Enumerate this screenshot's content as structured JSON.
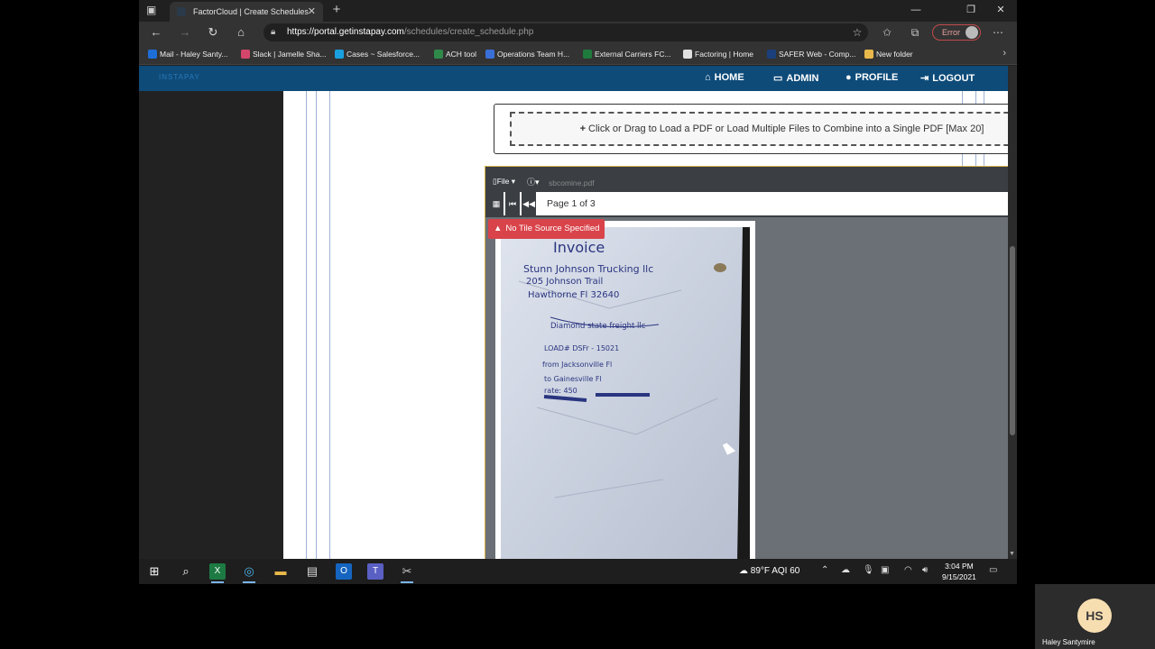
{
  "browser": {
    "tab_title": "FactorCloud | Create Schedules",
    "tab_close": "✕",
    "new_tab": "+",
    "url_host": "https://portal.getinstapay.com",
    "url_path": "/schedules/create_schedule.php",
    "error_label": "Error",
    "favorites": [
      {
        "label": "Mail - Haley Santy...",
        "color": "#1e6ed8"
      },
      {
        "label": "Slack | Jamelle Sha...",
        "color": "#d3466b"
      },
      {
        "label": "Cases ~ Salesforce...",
        "color": "#1aa0e0"
      },
      {
        "label": "ACH tool",
        "color": "#2f8a4a"
      },
      {
        "label": "Operations Team H...",
        "color": "#3a6fd8"
      },
      {
        "label": "External Carriers FC...",
        "color": "#1f7a3d"
      },
      {
        "label": "Factoring | Home",
        "color": "#e0e0e0"
      },
      {
        "label": "SAFER Web - Comp...",
        "color": "#1a3f7a"
      },
      {
        "label": "New folder",
        "color": "#e8b84a"
      }
    ]
  },
  "site": {
    "brand": "INSTAPAY",
    "nav": {
      "home": "HOME",
      "admin": "ADMIN",
      "profile": "PROFILE",
      "logout": "LOGOUT"
    },
    "upload_text": "Click or Drag to Load a PDF or Load Multiple Files to Combine into a Single PDF [Max 20]"
  },
  "viewer": {
    "file_menu": "File",
    "file_name": "sbcomine.pdf",
    "page_label": "Page 1 of 3",
    "alert": "No Tile Source Specified",
    "document_text": {
      "heading": "Invoice",
      "line1": "Stunn Johnson Trucking llc",
      "line2": "205 Johnson Trail",
      "line3": "Hawthorne Fl 32640",
      "line4": "Diamond state freight llc",
      "line5": "LOAD# DSFr - 15021",
      "line6": "from Jacksonville Fl",
      "line7": "to Gainesville Fl",
      "line8": "rate: 450"
    }
  },
  "taskbar": {
    "weather": "89°F  AQI 60",
    "time": "3:04 PM",
    "date": "9/15/2021"
  },
  "webcam": {
    "initials": "HS",
    "name": "Haley Santymire"
  }
}
